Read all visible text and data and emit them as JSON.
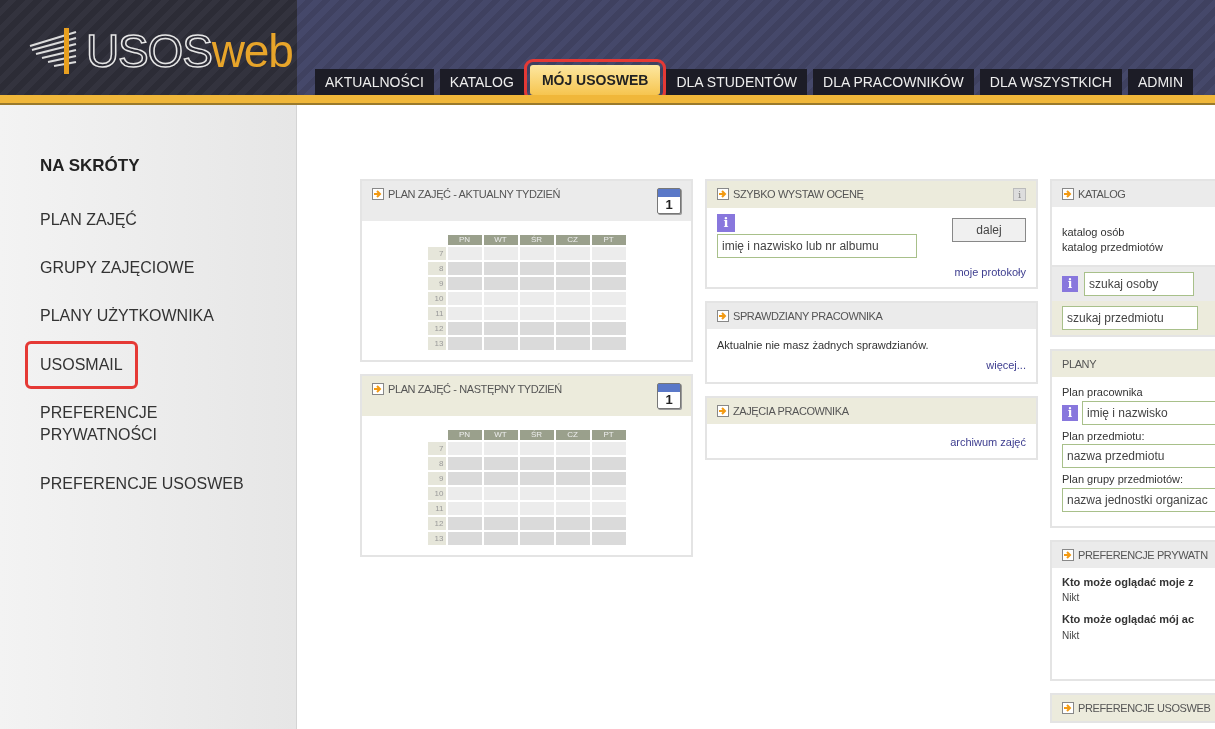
{
  "header": {
    "logo": {
      "main": "USOS",
      "accent": "web"
    },
    "tabs": [
      {
        "label": "AKTUALNOŚCI",
        "selected": false,
        "highlighted": false
      },
      {
        "label": "KATALOG",
        "selected": false,
        "highlighted": false
      },
      {
        "label": "MÓJ USOSWEB",
        "selected": true,
        "highlighted": true
      },
      {
        "label": "DLA STUDENTÓW",
        "selected": false,
        "highlighted": false
      },
      {
        "label": "DLA PRACOWNIKÓW",
        "selected": false,
        "highlighted": false
      },
      {
        "label": "DLA WSZYSTKICH",
        "selected": false,
        "highlighted": false
      },
      {
        "label": "ADMIN",
        "selected": false,
        "highlighted": false
      }
    ]
  },
  "sidebar": {
    "heading": "NA SKRÓTY",
    "items": [
      {
        "label": "PLAN ZAJĘĆ",
        "highlighted": false
      },
      {
        "label": "GRUPY ZAJĘCIOWE",
        "highlighted": false
      },
      {
        "label": "PLANY UŻYTKOWNIKA",
        "highlighted": false
      },
      {
        "label": "USOSMAIL",
        "highlighted": true
      },
      {
        "label": "PREFERENCJE PRYWATNOŚCI",
        "highlighted": false
      },
      {
        "label": "PREFERENCJE USOSWEB",
        "highlighted": false
      }
    ]
  },
  "columns": [
    [
      {
        "kind": "timetable",
        "title": "PLAN ZAJĘĆ - AKTUALNY TYDZIEŃ",
        "color": "#ebebeb",
        "calendar": {
          "day": "1"
        },
        "days": [
          "PN",
          "WT",
          "ŚR",
          "CZ",
          "PT"
        ],
        "hours": [
          "7",
          "8",
          "9",
          "10",
          "11",
          "12",
          "13"
        ]
      },
      {
        "kind": "timetable",
        "title": "PLAN ZAJĘĆ - NASTĘPNY TYDZIEŃ",
        "color": "#ecebdc",
        "calendar": {
          "day": "1"
        },
        "days": [
          "PN",
          "WT",
          "ŚR",
          "CZ",
          "PT"
        ],
        "hours": [
          "7",
          "8",
          "9",
          "10",
          "11",
          "12",
          "13"
        ]
      }
    ],
    [
      {
        "kind": "quick_grade",
        "title": "SZYBKO WYSTAW OCENĘ",
        "color": "#ecebdc",
        "info_glyph": "i",
        "header_glyph": "i",
        "placeholder": "imię i nazwisko lub nr albumu",
        "button": "dalej",
        "link": "moje protokoły"
      },
      {
        "kind": "text_link",
        "title": "SPRAWDZIANY PRACOWNIKA",
        "color": "#ebebeb",
        "text": "Aktualnie nie masz żadnych sprawdzianów.",
        "link": "więcej..."
      },
      {
        "kind": "text_link",
        "title": "ZAJĘCIA PRACOWNIKA",
        "color": "#ecebdc",
        "link": "archiwum zajęć"
      }
    ],
    [
      {
        "kind": "catalog",
        "title": "KATALOG",
        "color": "#ebebeb",
        "links": [
          "katalog osób",
          "katalog przedmiotów"
        ],
        "fields": [
          {
            "placeholder": "szukaj osoby",
            "info_glyph": "i"
          },
          {
            "placeholder": "szukaj przedmiotu"
          }
        ]
      },
      {
        "kind": "plans",
        "title": "PLANY",
        "color": "#ecebdc",
        "groups": [
          {
            "label": "Plan pracownika",
            "placeholder": "imię i nazwisko",
            "info_glyph": "i"
          },
          {
            "label": "Plan przedmiotu:",
            "placeholder": "nazwa przedmiotu"
          },
          {
            "label": "Plan grupy przedmiotów:",
            "placeholder": "nazwa jednostki organizac"
          }
        ]
      },
      {
        "kind": "privacy",
        "title": "PREFERENCJE PRYWATN",
        "color": "#ebebeb",
        "items": [
          {
            "question": "Kto może oglądać moje z",
            "answer": "Nikt"
          },
          {
            "question": "Kto może oglądać mój ac",
            "answer": "Nikt"
          }
        ]
      },
      {
        "kind": "empty",
        "title": "PREFERENCJE USOSWEB",
        "color": "#ecebdc"
      }
    ]
  ]
}
